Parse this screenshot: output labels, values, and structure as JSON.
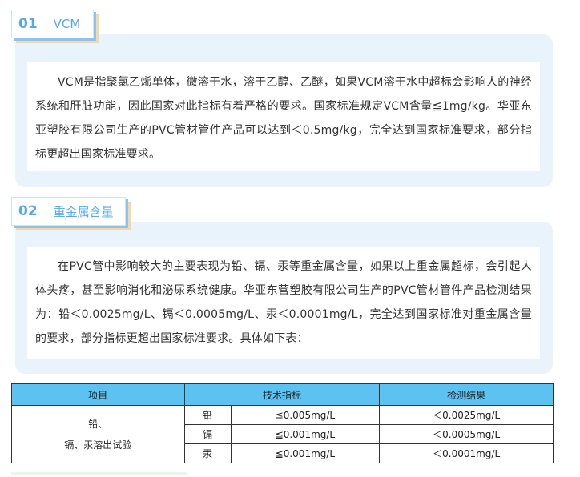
{
  "section1": {
    "number": "01",
    "title": "VCM",
    "paragraph": "VCM是指聚氯乙烯单体，微溶于水，溶于乙醇、乙醚，如果VCM溶于水中超标会影响人的神经系统和肝脏功能，因此国家对此指标有着严格的要求。国家标准规定VCM含量≦1mg/kg。华亚东亚塑胶有限公司生产的PVC管材管件产品可以达到＜0.5mg/kg，完全达到国家标准要求，部分指标更超出国家标准要求。"
  },
  "section2": {
    "number": "02",
    "title": "重金属含量",
    "paragraph": "在PVC管中影响较大的主要表现为铅、镉、汞等重金属含量，如果以上重金属超标，会引起人体头疼，甚至影响消化和泌尿系统健康。华亚东营塑胶有限公司生产的PVC管材管件产品检测结果为：铅＜0.0025mg/L、镉＜0.0005mg/L、汞＜0.0001mg/L，完全达到国家标准对重金属含量的要求，部分指标更超出国家标准要求。具体如下表："
  },
  "table": {
    "headers": [
      "项目",
      "技术指标",
      "检测结果"
    ],
    "item_line1": "铅、",
    "item_line2": "镉、汞溶出试验",
    "rows": [
      {
        "element": "铅",
        "spec": "≦0.005mg/L",
        "result": "＜0.0025mg/L"
      },
      {
        "element": "镉",
        "spec": "≦0.001mg/L",
        "result": "＜0.0005mg/L"
      },
      {
        "element": "汞",
        "spec": "≦0.001mg/L",
        "result": "＜0.0001mg/L"
      }
    ]
  },
  "colors": {
    "accent_blue": "#5aa7e6",
    "panel_bg": "#e9f3fc",
    "table_header": "#5bc2f1",
    "tab_shadow_orange": "#f4d9a8"
  }
}
